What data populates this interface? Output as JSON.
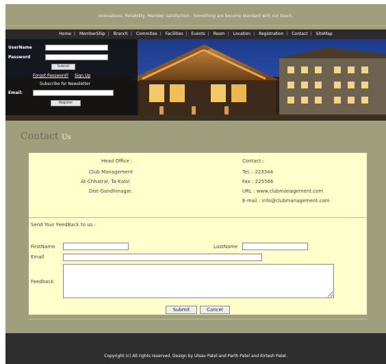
{
  "header": {
    "tagline": "Innovations, Reliability, Member satisfaction - Something are become standard with our touch."
  },
  "nav": {
    "items": [
      "Home",
      "MemberShip",
      "Branch",
      "Commitee",
      "Facilities",
      "Events",
      "Room",
      "Location",
      "Registration",
      "Contact",
      "SiteMap"
    ]
  },
  "login": {
    "username_label": "UserName",
    "password_label": "Password",
    "submit_label": "Submit",
    "forgot_label": "Forgot Password?",
    "signup_label": "Sign Up",
    "newsletter_label": "Subscribe for Newsletter",
    "email_label": "Email:",
    "register_label": "Register"
  },
  "page": {
    "title": "Contact",
    "title_suffix": "Us"
  },
  "head_office": {
    "heading": "Head Office :",
    "line1": "Club Management",
    "line2": "At-Chhatral, Ta-Kalol",
    "line3": "Dist-Gandhinagar."
  },
  "contact_info": {
    "heading": "Contact :",
    "tel": "Tel. : 223344",
    "fax": "Fax : 225566",
    "url": "URL : www.clubmanagement.com",
    "email": "E-mail : info@clubmanagement.com"
  },
  "feedback": {
    "heading": "Send Your FeedBack to us :",
    "firstname_label": "FirstName",
    "lastname_label": "LastName",
    "email_label": "Email",
    "feedback_label": "Feedback",
    "submit_label": "Submit",
    "cancel_label": "Cancel"
  },
  "footer": {
    "copyright": "Copyright (c) All rights reserved. Design by Utsav Patel and Parth Patel and Kirtesh Patel."
  },
  "colors": {
    "page_bg": "#9f9f7e",
    "content_bg": "#ffffcc",
    "nav_bg": "#2a2a2a",
    "footer_bg": "#2e2e2e"
  }
}
